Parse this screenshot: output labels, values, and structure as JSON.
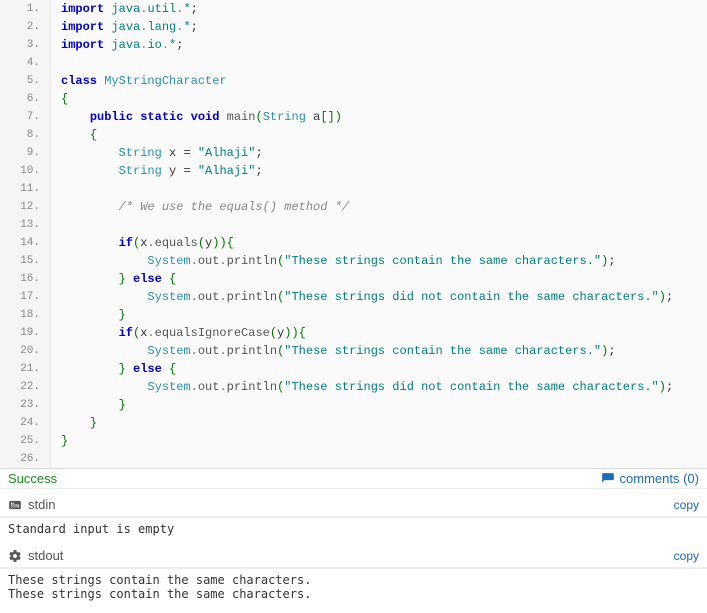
{
  "status": {
    "text": "Success",
    "comments": "comments (0)"
  },
  "stdin": {
    "title": "stdin",
    "copy": "copy",
    "content": "Standard input is empty"
  },
  "stdout": {
    "title": "stdout",
    "copy": "copy",
    "content": "These strings contain the same characters.\nThese strings contain the same characters."
  },
  "lines": [
    {
      "n": "1.",
      "tokens": [
        [
          "kw",
          "import"
        ],
        [
          "",
          " "
        ],
        [
          "pkg",
          "java"
        ],
        [
          "dot",
          "."
        ],
        [
          "pkg",
          "util"
        ],
        [
          "dot",
          "."
        ],
        [
          "pkg",
          "*"
        ],
        [
          "",
          ";"
        ]
      ]
    },
    {
      "n": "2.",
      "tokens": [
        [
          "kw",
          "import"
        ],
        [
          "",
          " "
        ],
        [
          "pkg",
          "java"
        ],
        [
          "dot",
          "."
        ],
        [
          "pkg",
          "lang"
        ],
        [
          "dot",
          "."
        ],
        [
          "pkg",
          "*"
        ],
        [
          "",
          ";"
        ]
      ]
    },
    {
      "n": "3.",
      "tokens": [
        [
          "kw",
          "import"
        ],
        [
          "",
          " "
        ],
        [
          "pkg",
          "java"
        ],
        [
          "dot",
          "."
        ],
        [
          "pkg",
          "io"
        ],
        [
          "dot",
          "."
        ],
        [
          "pkg",
          "*"
        ],
        [
          "",
          ";"
        ]
      ]
    },
    {
      "n": "4.",
      "tokens": []
    },
    {
      "n": "5.",
      "tokens": [
        [
          "kw",
          "class"
        ],
        [
          "",
          " "
        ],
        [
          "cls",
          "MyStringCharacter"
        ]
      ]
    },
    {
      "n": "6.",
      "tokens": [
        [
          "brace",
          "{"
        ]
      ]
    },
    {
      "n": "7.",
      "tokens": [
        [
          "",
          "    "
        ],
        [
          "kw",
          "public"
        ],
        [
          "",
          " "
        ],
        [
          "kw",
          "static"
        ],
        [
          "",
          " "
        ],
        [
          "kw",
          "void"
        ],
        [
          "",
          " "
        ],
        [
          "id",
          "main"
        ],
        [
          "paren",
          "("
        ],
        [
          "cls",
          "String"
        ],
        [
          "",
          " a"
        ],
        [
          "paren",
          "["
        ],
        [
          "paren",
          "]"
        ],
        [
          "paren",
          ")"
        ]
      ]
    },
    {
      "n": "8.",
      "tokens": [
        [
          "",
          "    "
        ],
        [
          "brace",
          "{"
        ]
      ]
    },
    {
      "n": "9.",
      "tokens": [
        [
          "",
          "        "
        ],
        [
          "cls",
          "String"
        ],
        [
          "",
          " x "
        ],
        [
          "",
          "="
        ],
        [
          "",
          " "
        ],
        [
          "str",
          "\"Alhaji\""
        ],
        [
          "",
          ";"
        ]
      ]
    },
    {
      "n": "10.",
      "tokens": [
        [
          "",
          "        "
        ],
        [
          "cls",
          "String"
        ],
        [
          "",
          " y "
        ],
        [
          "",
          "="
        ],
        [
          "",
          " "
        ],
        [
          "str",
          "\"Alhaji\""
        ],
        [
          "",
          ";"
        ]
      ]
    },
    {
      "n": "11.",
      "tokens": []
    },
    {
      "n": "12.",
      "tokens": [
        [
          "",
          "        "
        ],
        [
          "com",
          "/* We use the equals() method */"
        ]
      ]
    },
    {
      "n": "13.",
      "tokens": []
    },
    {
      "n": "14.",
      "tokens": [
        [
          "",
          "        "
        ],
        [
          "kw",
          "if"
        ],
        [
          "paren",
          "("
        ],
        [
          "",
          "x"
        ],
        [
          "dot",
          "."
        ],
        [
          "id",
          "equals"
        ],
        [
          "paren",
          "("
        ],
        [
          "",
          "y"
        ],
        [
          "paren",
          ")"
        ],
        [
          "paren",
          ")"
        ],
        [
          "brace",
          "{"
        ]
      ]
    },
    {
      "n": "15.",
      "tokens": [
        [
          "",
          "            "
        ],
        [
          "cls",
          "System"
        ],
        [
          "dot",
          "."
        ],
        [
          "id",
          "out"
        ],
        [
          "dot",
          "."
        ],
        [
          "id",
          "println"
        ],
        [
          "paren",
          "("
        ],
        [
          "str",
          "\"These strings contain the same characters.\""
        ],
        [
          "paren",
          ")"
        ],
        [
          "",
          ";"
        ]
      ]
    },
    {
      "n": "16.",
      "tokens": [
        [
          "",
          "        "
        ],
        [
          "brace",
          "}"
        ],
        [
          "",
          " "
        ],
        [
          "kw",
          "else"
        ],
        [
          "",
          " "
        ],
        [
          "brace",
          "{"
        ]
      ]
    },
    {
      "n": "17.",
      "tokens": [
        [
          "",
          "            "
        ],
        [
          "cls",
          "System"
        ],
        [
          "dot",
          "."
        ],
        [
          "id",
          "out"
        ],
        [
          "dot",
          "."
        ],
        [
          "id",
          "println"
        ],
        [
          "paren",
          "("
        ],
        [
          "str",
          "\"These strings did not contain the same characters.\""
        ],
        [
          "paren",
          ")"
        ],
        [
          "",
          ";"
        ]
      ]
    },
    {
      "n": "18.",
      "tokens": [
        [
          "",
          "        "
        ],
        [
          "brace",
          "}"
        ]
      ]
    },
    {
      "n": "19.",
      "tokens": [
        [
          "",
          "        "
        ],
        [
          "kw",
          "if"
        ],
        [
          "paren",
          "("
        ],
        [
          "",
          "x"
        ],
        [
          "dot",
          "."
        ],
        [
          "id",
          "equalsIgnoreCase"
        ],
        [
          "paren",
          "("
        ],
        [
          "",
          "y"
        ],
        [
          "paren",
          ")"
        ],
        [
          "paren",
          ")"
        ],
        [
          "brace",
          "{"
        ]
      ]
    },
    {
      "n": "20.",
      "tokens": [
        [
          "",
          "            "
        ],
        [
          "cls",
          "System"
        ],
        [
          "dot",
          "."
        ],
        [
          "id",
          "out"
        ],
        [
          "dot",
          "."
        ],
        [
          "id",
          "println"
        ],
        [
          "paren",
          "("
        ],
        [
          "str",
          "\"These strings contain the same characters.\""
        ],
        [
          "paren",
          ")"
        ],
        [
          "",
          ";"
        ]
      ]
    },
    {
      "n": "21.",
      "tokens": [
        [
          "",
          "        "
        ],
        [
          "brace",
          "}"
        ],
        [
          "",
          " "
        ],
        [
          "kw",
          "else"
        ],
        [
          "",
          " "
        ],
        [
          "brace",
          "{"
        ]
      ]
    },
    {
      "n": "22.",
      "tokens": [
        [
          "",
          "            "
        ],
        [
          "cls",
          "System"
        ],
        [
          "dot",
          "."
        ],
        [
          "id",
          "out"
        ],
        [
          "dot",
          "."
        ],
        [
          "id",
          "println"
        ],
        [
          "paren",
          "("
        ],
        [
          "str",
          "\"These strings did not contain the same characters.\""
        ],
        [
          "paren",
          ")"
        ],
        [
          "",
          ";"
        ]
      ]
    },
    {
      "n": "23.",
      "tokens": [
        [
          "",
          "        "
        ],
        [
          "brace",
          "}"
        ]
      ]
    },
    {
      "n": "24.",
      "tokens": [
        [
          "",
          "    "
        ],
        [
          "brace",
          "}"
        ]
      ]
    },
    {
      "n": "25.",
      "tokens": [
        [
          "brace",
          "}"
        ]
      ]
    },
    {
      "n": "26.",
      "tokens": []
    }
  ]
}
